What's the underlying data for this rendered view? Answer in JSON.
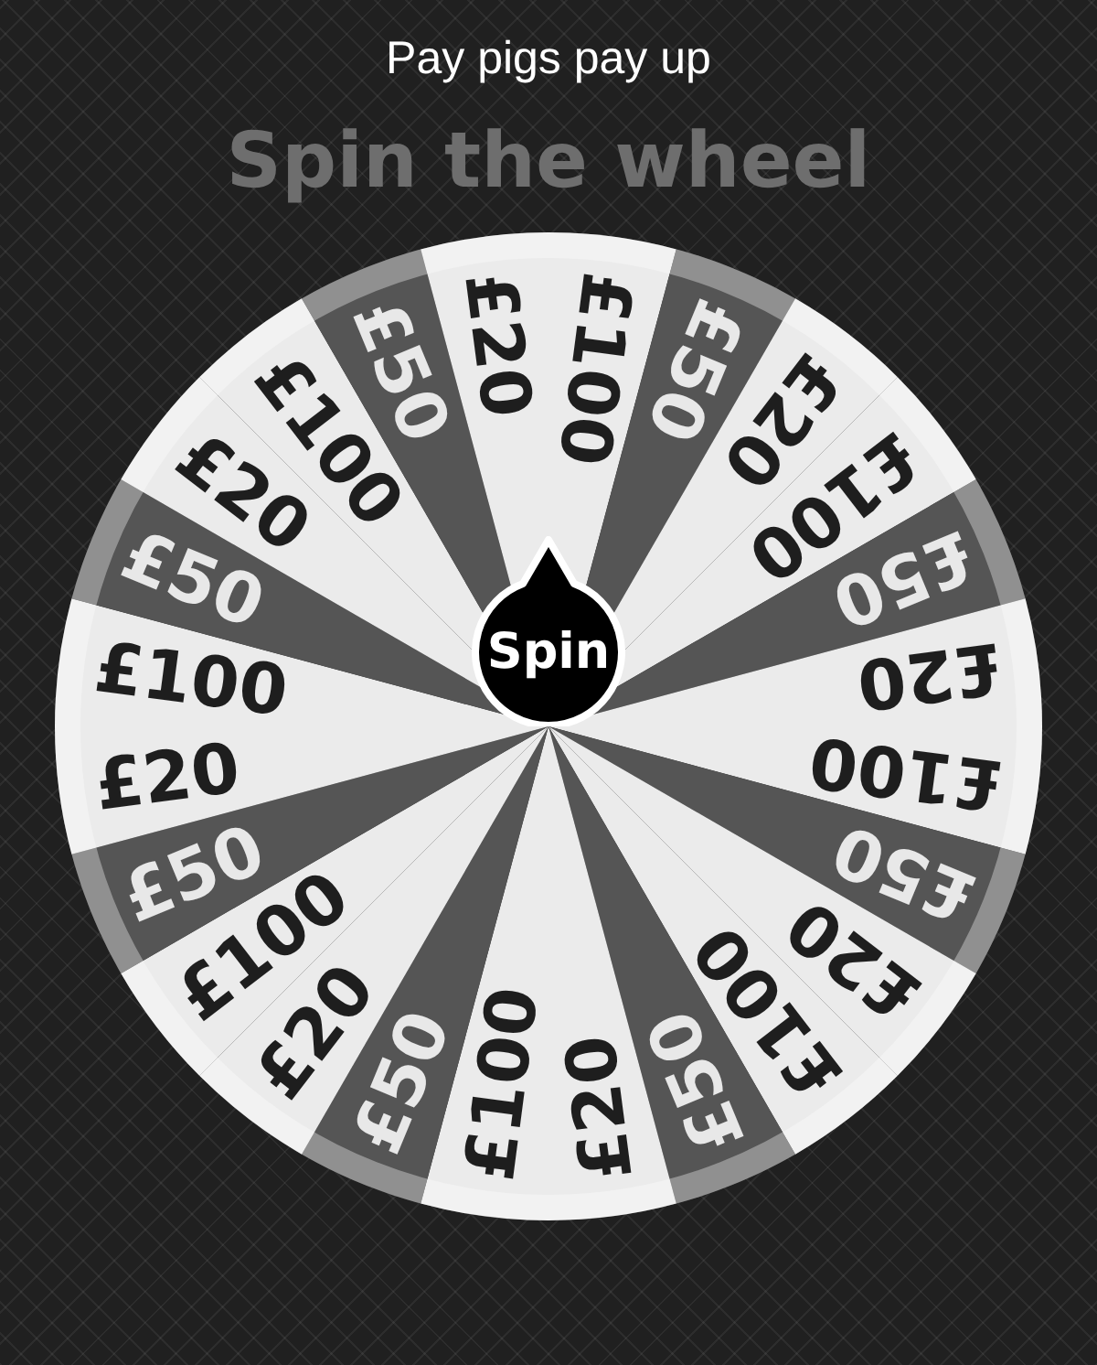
{
  "header": {
    "title": "Pay pigs pay up",
    "heading": "Spin the wheel"
  },
  "wheel": {
    "segments": [
      {
        "label": "£100",
        "color": "#ebebeb"
      },
      {
        "label": "£50",
        "color": "#555555"
      },
      {
        "label": "£20",
        "color": "#ebebeb"
      },
      {
        "label": "£100",
        "color": "#ebebeb"
      },
      {
        "label": "£50",
        "color": "#555555"
      },
      {
        "label": "£20",
        "color": "#ebebeb"
      },
      {
        "label": "£100",
        "color": "#ebebeb"
      },
      {
        "label": "£50",
        "color": "#555555"
      },
      {
        "label": "£20",
        "color": "#ebebeb"
      },
      {
        "label": "£100",
        "color": "#ebebeb"
      },
      {
        "label": "£50",
        "color": "#555555"
      },
      {
        "label": "£20",
        "color": "#ebebeb"
      },
      {
        "label": "£100",
        "color": "#ebebeb"
      },
      {
        "label": "£50",
        "color": "#555555"
      },
      {
        "label": "£20",
        "color": "#ebebeb"
      },
      {
        "label": "£100",
        "color": "#ebebeb"
      },
      {
        "label": "£50",
        "color": "#555555"
      },
      {
        "label": "£20",
        "color": "#ebebeb"
      },
      {
        "label": "£100",
        "color": "#ebebeb"
      },
      {
        "label": "£50",
        "color": "#555555"
      },
      {
        "label": "£20",
        "color": "#ebebeb"
      },
      {
        "label": "£100",
        "color": "#ebebeb"
      },
      {
        "label": "£50",
        "color": "#555555"
      },
      {
        "label": "£20",
        "color": "#ebebeb"
      }
    ],
    "spin_button": "Spin"
  }
}
